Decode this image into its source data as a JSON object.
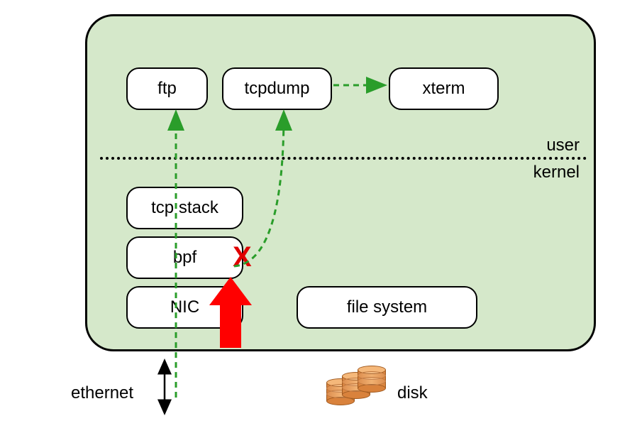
{
  "boxes": {
    "ftp": "ftp",
    "tcpdump": "tcpdump",
    "xterm": "xterm",
    "tcpstack": "tcp stack",
    "bpf": "bpf",
    "nic": "NIC",
    "filesystem": "file system"
  },
  "labels": {
    "user": "user",
    "kernel": "kernel",
    "ethernet": "ethernet",
    "disk": "disk"
  },
  "marks": {
    "x": "X"
  },
  "colors": {
    "container_bg": "#d5e8ca",
    "arrow_green": "#2a9d2a",
    "x_red": "#e00000",
    "big_arrow_red": "#ff0000",
    "disk_orange": "#e09050"
  }
}
